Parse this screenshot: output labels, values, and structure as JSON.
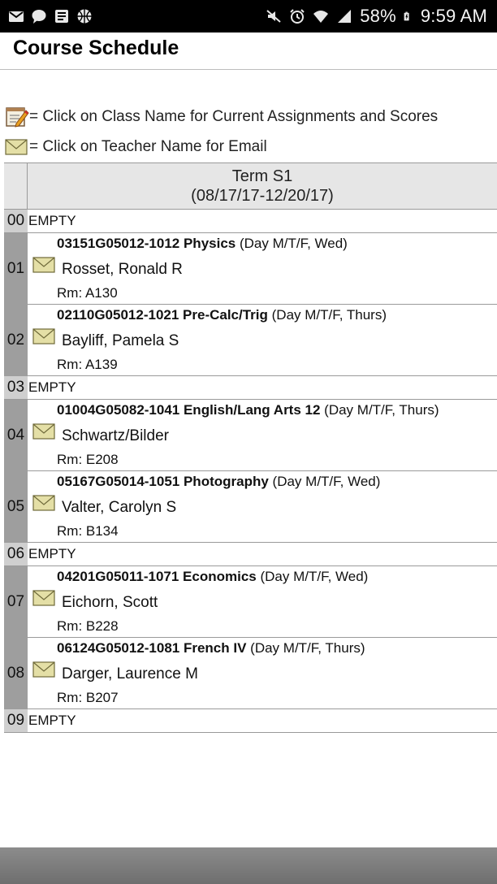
{
  "status_bar": {
    "battery": "58%",
    "time": "9:59 AM",
    "left_icons": [
      "gmail-icon",
      "chat-icon",
      "news-icon",
      "basketball-icon"
    ],
    "right_icons": [
      "mute-icon",
      "alarm-icon",
      "wifi-icon",
      "signal-icon",
      "battery-icon"
    ]
  },
  "header": {
    "title": "Course Schedule"
  },
  "legend": {
    "assignments": "= Click on Class Name for Current Assignments and Scores",
    "email": "= Click on Teacher Name for Email"
  },
  "term": {
    "name": "Term S1",
    "dates": "(08/17/17-12/20/17)"
  },
  "rows": [
    {
      "period": "00",
      "empty_label": "EMPTY"
    },
    {
      "period": "01",
      "course": "03151G05012-1012 Physics",
      "days": " (Day M/T/F, Wed)",
      "teacher": "Rosset, Ronald R",
      "room": "Rm: A130"
    },
    {
      "period": "02",
      "course": "02110G05012-1021 Pre-Calc/Trig",
      "days": " (Day M/T/F, Thurs)",
      "teacher": "Bayliff, Pamela S",
      "room": "Rm: A139"
    },
    {
      "period": "03",
      "empty_label": "EMPTY"
    },
    {
      "period": "04",
      "course": "01004G05082-1041 English/Lang Arts 12",
      "days": " (Day M/T/F, Thurs)",
      "teacher": "Schwartz/Bilder",
      "room": "Rm: E208"
    },
    {
      "period": "05",
      "course": "05167G05014-1051 Photography",
      "days": " (Day M/T/F, Wed)",
      "teacher": "Valter, Carolyn S",
      "room": "Rm: B134"
    },
    {
      "period": "06",
      "empty_label": "EMPTY"
    },
    {
      "period": "07",
      "course": "04201G05011-1071 Economics",
      "days": " (Day M/T/F, Wed)",
      "teacher": "Eichorn, Scott",
      "room": "Rm: B228"
    },
    {
      "period": "08",
      "course": "06124G05012-1081 French IV",
      "days": " (Day M/T/F, Thurs)",
      "teacher": "Darger, Laurence M",
      "room": "Rm: B207"
    },
    {
      "period": "09",
      "empty_label": "EMPTY"
    }
  ]
}
